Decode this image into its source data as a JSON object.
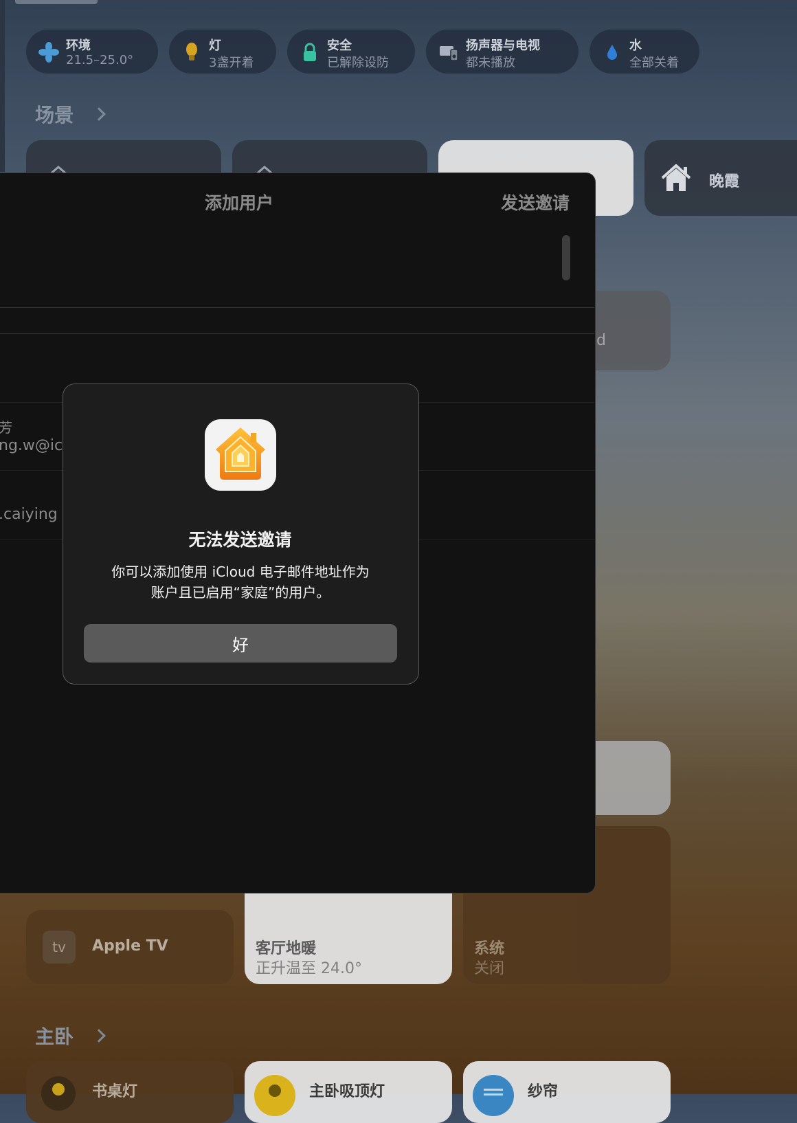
{
  "status_pills": [
    {
      "icon": "fan-icon",
      "title": "环境",
      "subtitle": "21.5–25.0°"
    },
    {
      "icon": "lightbulb-icon",
      "title": "灯",
      "subtitle": "3盏开着"
    },
    {
      "icon": "lock-icon",
      "title": "安全",
      "subtitle": "已解除设防"
    },
    {
      "icon": "speaker-tv-icon",
      "title": "扬声器与电视",
      "subtitle": "都未播放"
    },
    {
      "icon": "water-drop-icon",
      "title": "水",
      "subtitle": "全部关着"
    }
  ],
  "sections": {
    "scenes": "场景",
    "master_bedroom": "主卧"
  },
  "scenes": [
    {
      "icon": "house-icon",
      "label": "晚霞"
    }
  ],
  "sheet": {
    "title": "添加用户",
    "send_invite": "发送邀请",
    "rows": [
      {
        "name": "芳",
        "email": "ng.w@ic"
      },
      {
        "email": ".caiying"
      }
    ]
  },
  "alert": {
    "title": "无法发送邀请",
    "message_line1": "你可以添加使用 iCloud 电子邮件地址作为",
    "message_line2": "账户且已启用“家庭”的用户。",
    "ok": "好"
  },
  "accessories": [
    {
      "icon": "appletv-icon",
      "icon_text": "tv",
      "name": "Apple TV"
    },
    {
      "name": "客厅地暖",
      "status": "正升温至 24.0°"
    },
    {
      "name": "系统",
      "status": "关闭"
    }
  ],
  "bedroom_accessories": [
    {
      "icon": "lamp-icon",
      "name": "书桌灯"
    },
    {
      "icon": "ceiling-light-icon",
      "name": "主卧吸顶灯"
    },
    {
      "icon": "curtain-icon",
      "name": "纱帘"
    }
  ],
  "colors": {
    "accent_orange": "#F5A623",
    "alert_bg": "#1d1d1d",
    "sheet_bg": "#121212"
  }
}
